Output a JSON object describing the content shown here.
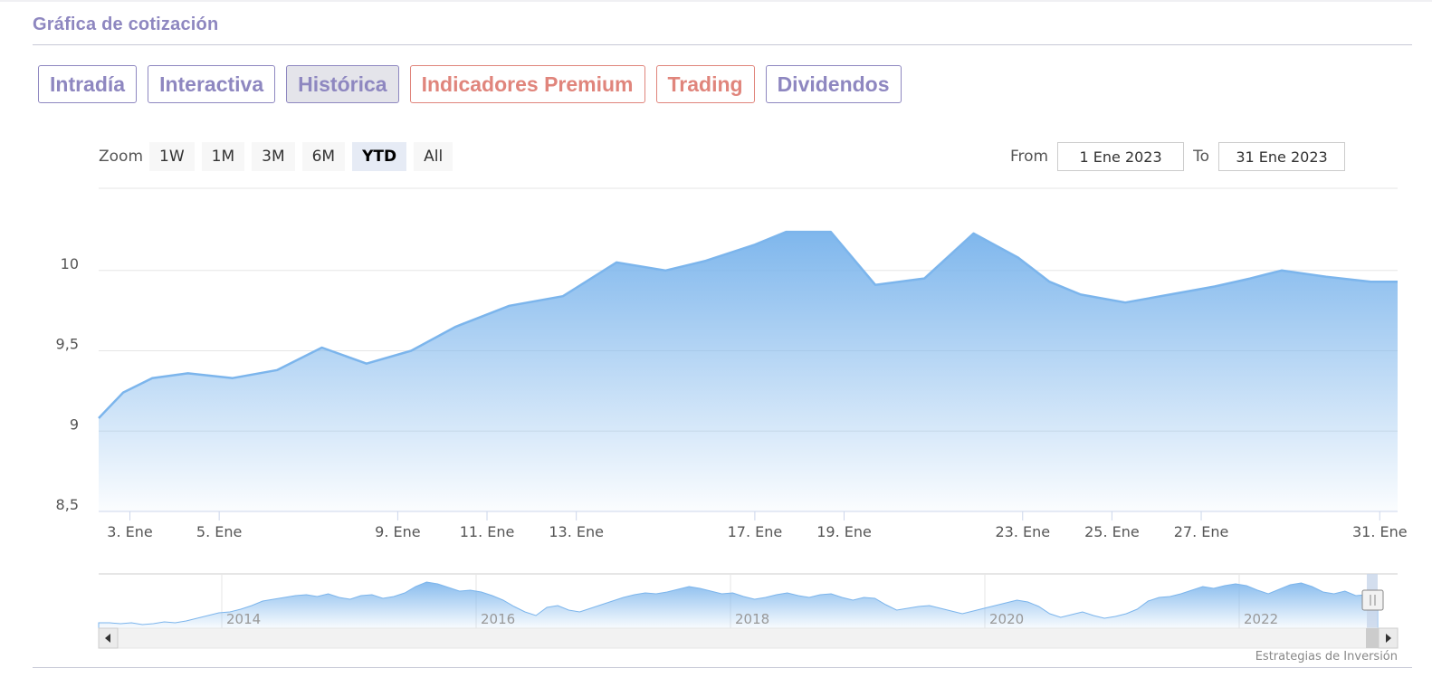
{
  "header": {
    "title": "Gráfica de cotización"
  },
  "tabs": [
    {
      "label": "Intradía",
      "active": false,
      "premium": false
    },
    {
      "label": "Interactiva",
      "active": false,
      "premium": false
    },
    {
      "label": "Histórica",
      "active": true,
      "premium": false
    },
    {
      "label": "Indicadores Premium",
      "active": false,
      "premium": true
    },
    {
      "label": "Trading",
      "active": false,
      "premium": true
    },
    {
      "label": "Dividendos",
      "active": false,
      "premium": false
    }
  ],
  "zoom": {
    "label": "Zoom",
    "buttons": [
      "1W",
      "1M",
      "3M",
      "6M",
      "YTD",
      "All"
    ],
    "active": "YTD"
  },
  "range": {
    "from_label": "From",
    "from_value": "1 Ene 2023",
    "to_label": "To",
    "to_value": "31 Ene 2023"
  },
  "credits": "Estrategias de Inversión",
  "colors": {
    "accent": "#8e87c0",
    "premium": "#e0857c",
    "series": "#7cb5ec"
  },
  "chart_data": {
    "type": "area",
    "ylim": [
      8.5,
      10.5
    ],
    "xlim": [
      2.3,
      31.4
    ],
    "y_ticks": [
      8.5,
      9,
      9.5,
      10
    ],
    "y_tick_labels": [
      "8,5",
      "9",
      "9,5",
      "10"
    ],
    "x_ticks": [
      3,
      5,
      9,
      11,
      13,
      17,
      19,
      23,
      25,
      27,
      31
    ],
    "x_tick_labels": [
      "3. Ene",
      "5. Ene",
      "9. Ene",
      "11. Ene",
      "13. Ene",
      "17. Ene",
      "19. Ene",
      "23. Ene",
      "25. Ene",
      "27. Ene",
      "31. Ene"
    ],
    "grid": true,
    "series": [
      {
        "x": [
          2.3,
          2.85,
          3.5,
          4.3,
          5.3,
          6.3,
          7.3,
          8.3,
          9.3,
          10.3,
          11.5,
          12.7,
          13.9,
          15.0,
          15.9,
          17.0,
          17.7,
          18.7,
          19.7,
          20.8,
          21.9,
          22.9,
          23.6,
          24.3,
          25.3,
          26.3,
          27.3,
          28.1,
          28.8,
          29.8,
          30.8,
          31.4
        ],
        "y": [
          9.08,
          9.24,
          9.33,
          9.36,
          9.33,
          9.38,
          9.52,
          9.42,
          9.5,
          9.65,
          9.78,
          9.84,
          10.05,
          10.0,
          10.06,
          10.16,
          10.24,
          10.24,
          9.91,
          9.95,
          10.23,
          10.08,
          9.93,
          9.85,
          9.8,
          9.85,
          9.9,
          9.95,
          10.0,
          9.96,
          9.93,
          9.93
        ]
      }
    ],
    "navigator": {
      "x_labels": [
        "2014",
        "2016",
        "2018",
        "2020",
        "2022"
      ]
    }
  }
}
